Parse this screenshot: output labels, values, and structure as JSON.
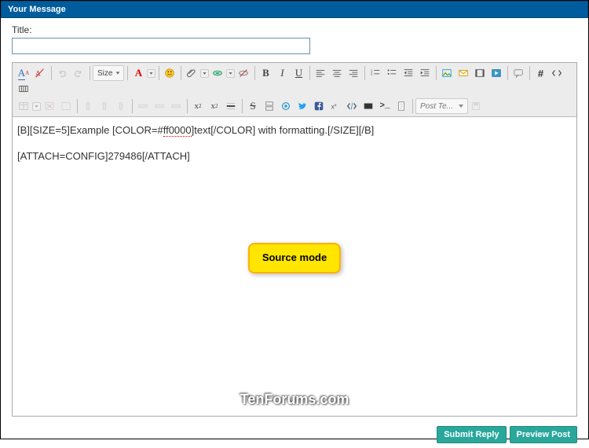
{
  "header": {
    "title": "Your Message"
  },
  "form": {
    "title_label": "Title:",
    "title_value": ""
  },
  "toolbar": {
    "size_label": "Size",
    "font_A": "A",
    "bold": "B",
    "italic": "I",
    "underline": "U",
    "hash": "#",
    "template_placeholder": "Post Te..."
  },
  "editor": {
    "line1_a": "[B][SIZE=5]Example [COLOR=#",
    "line1_spell": "ff0000",
    "line1_b": "]text[/COLOR] with formatting.[/SIZE][/B]",
    "line2": "[ATTACH=CONFIG]279486[/ATTACH]"
  },
  "tooltip": {
    "text": "Source mode"
  },
  "watermark": {
    "text": "TenForums.com"
  },
  "buttons": {
    "submit": "Submit Reply",
    "preview": "Preview Post"
  }
}
